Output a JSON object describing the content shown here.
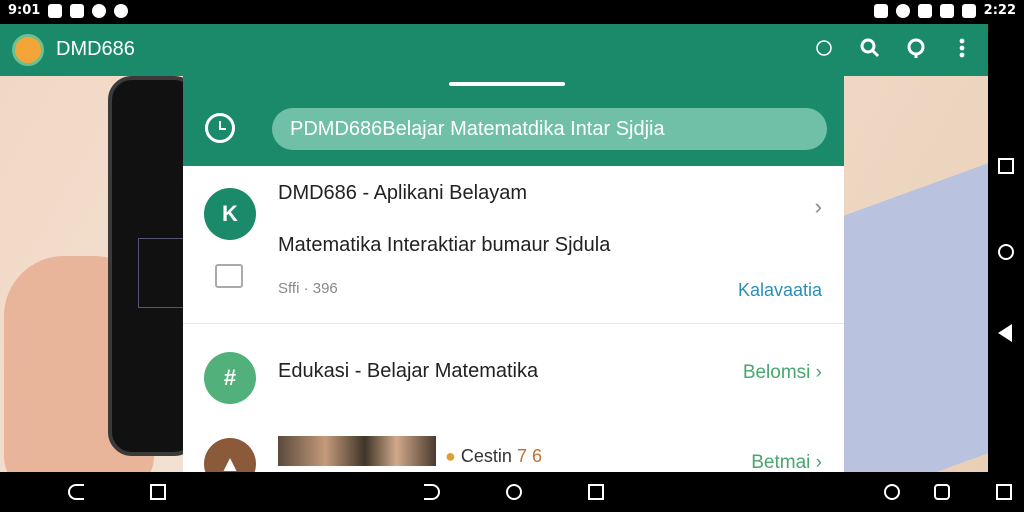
{
  "status_bar": {
    "time_left": "9:01",
    "time_right": "2:22",
    "left_icons": [
      "calendar-icon",
      "notification-icon",
      "signal-app-icon",
      "mail-icon"
    ],
    "right_icons": [
      "vibrate-icon",
      "location-icon",
      "wifi-icon",
      "signal-icon",
      "battery-icon"
    ]
  },
  "app_bar": {
    "title": "DMD686",
    "actions": [
      "history-icon",
      "search-icon",
      "account-icon",
      "more-vert-icon"
    ]
  },
  "sheet": {
    "search_value": "PDMD686Belajar Matematdika Intar Sjdjia",
    "items": [
      {
        "title": "DMD686 - Aplikani Belayam",
        "subtitle": "Matematika Interaktiar bumaur Sjdula",
        "meta": "Sffi · 396",
        "action": "Kalavaatia",
        "avatar_glyph": "K"
      },
      {
        "title": "Edukasi - Belajar Matematika",
        "action": "Belomsi",
        "avatar_glyph": "#"
      },
      {
        "rating_label": "Cestin",
        "rating_value": "7 6",
        "action": "Betmai"
      }
    ]
  },
  "colors": {
    "primary": "#1b8a6b",
    "search_bg": "#6fc0a6",
    "accent_blue": "#2a8fb8",
    "accent_green": "#4aa56f"
  }
}
